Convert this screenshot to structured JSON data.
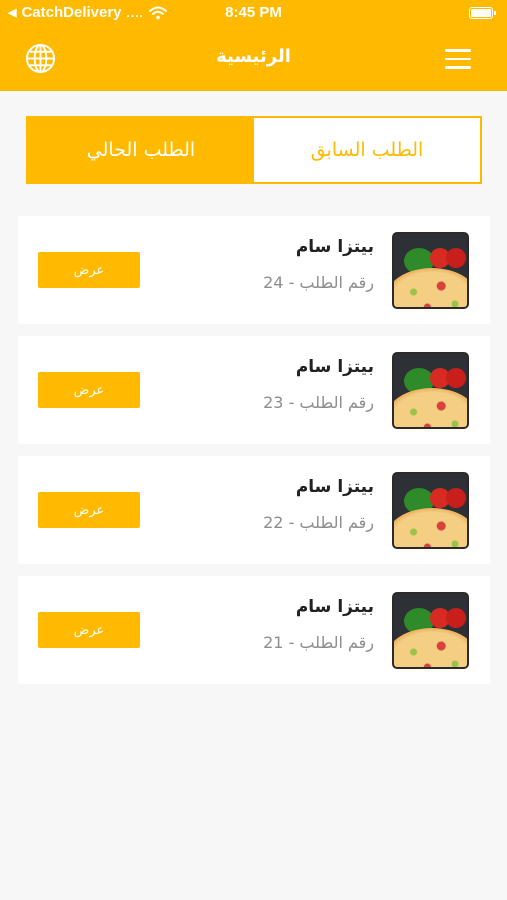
{
  "status_bar": {
    "back_label": "CatchDelivery",
    "signal": "....",
    "time": "8:45 PM",
    "icons": [
      "back-arrow-icon",
      "wifi-icon",
      "battery-icon"
    ]
  },
  "header": {
    "title": "الرئيسية",
    "left_icon": "globe-icon",
    "right_icon": "menu-icon"
  },
  "tabs": {
    "current": "الطلب الحالي",
    "previous": "الطلب السابق",
    "active": "current"
  },
  "orders": [
    {
      "name": "بيتزا سام",
      "order_label": "رقم الطلب - 24",
      "button": "عرض"
    },
    {
      "name": "بيتزا سام",
      "order_label": "رقم الطلب - 23",
      "button": "عرض"
    },
    {
      "name": "بيتزا سام",
      "order_label": "رقم الطلب - 22",
      "button": "عرض"
    },
    {
      "name": "بيتزا سام",
      "order_label": "رقم الطلب - 21",
      "button": "عرض"
    }
  ],
  "colors": {
    "accent": "#ffba00",
    "background": "#f7f7f7",
    "card": "#ffffff",
    "muted_text": "#8d8d8d"
  }
}
